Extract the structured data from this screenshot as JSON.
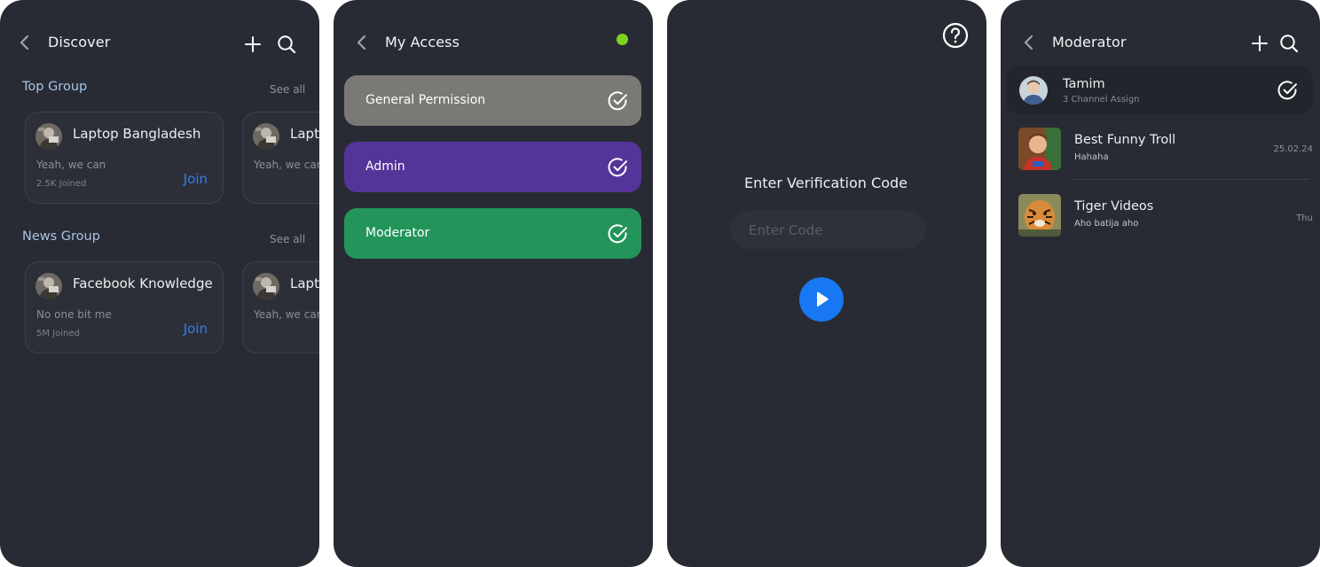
{
  "screens": {
    "discover": {
      "title": "Discover",
      "top_group": {
        "title": "Top Group",
        "see_all": "See all",
        "cards": [
          {
            "name": "Laptop Bangladesh",
            "message": "Yeah, we can",
            "members": "2.5K Joined",
            "action": "Join"
          },
          {
            "name": "Lapto",
            "message": "Yeah, we can"
          }
        ]
      },
      "news_group": {
        "title": "News Group",
        "see_all": "See all",
        "cards": [
          {
            "name": "Facebook Knowledge",
            "message": "No one bit me",
            "members": "5M Joined",
            "action": "Join"
          },
          {
            "name": "Lapto",
            "message": "Yeah, we can"
          }
        ]
      }
    },
    "my_access": {
      "title": "My Access",
      "status_color": "#7ed321",
      "permissions": [
        {
          "label": "General Permission",
          "color": "#7a7975"
        },
        {
          "label": "Admin",
          "color": "#55349a"
        },
        {
          "label": "Moderator",
          "color": "#23955a"
        }
      ]
    },
    "verification": {
      "title": "Enter Verification Code",
      "placeholder": "Enter Code"
    },
    "moderator": {
      "title": "Moderator",
      "selected": {
        "name": "Tamim",
        "subtitle": "3 Channel Assign"
      },
      "channels": [
        {
          "name": "Best Funny Troll",
          "last_message": "Hahaha",
          "time": "25.02.24"
        },
        {
          "name": "Tiger Videos",
          "last_message": "Aho batija aho",
          "time": "Thu"
        }
      ]
    }
  },
  "icons": {
    "back": "chevron-left-icon",
    "add": "plus-icon",
    "search": "search-icon",
    "check": "check-circle-icon",
    "help": "question-circle-icon",
    "play": "play-icon"
  },
  "accent": "#2f7ff0"
}
